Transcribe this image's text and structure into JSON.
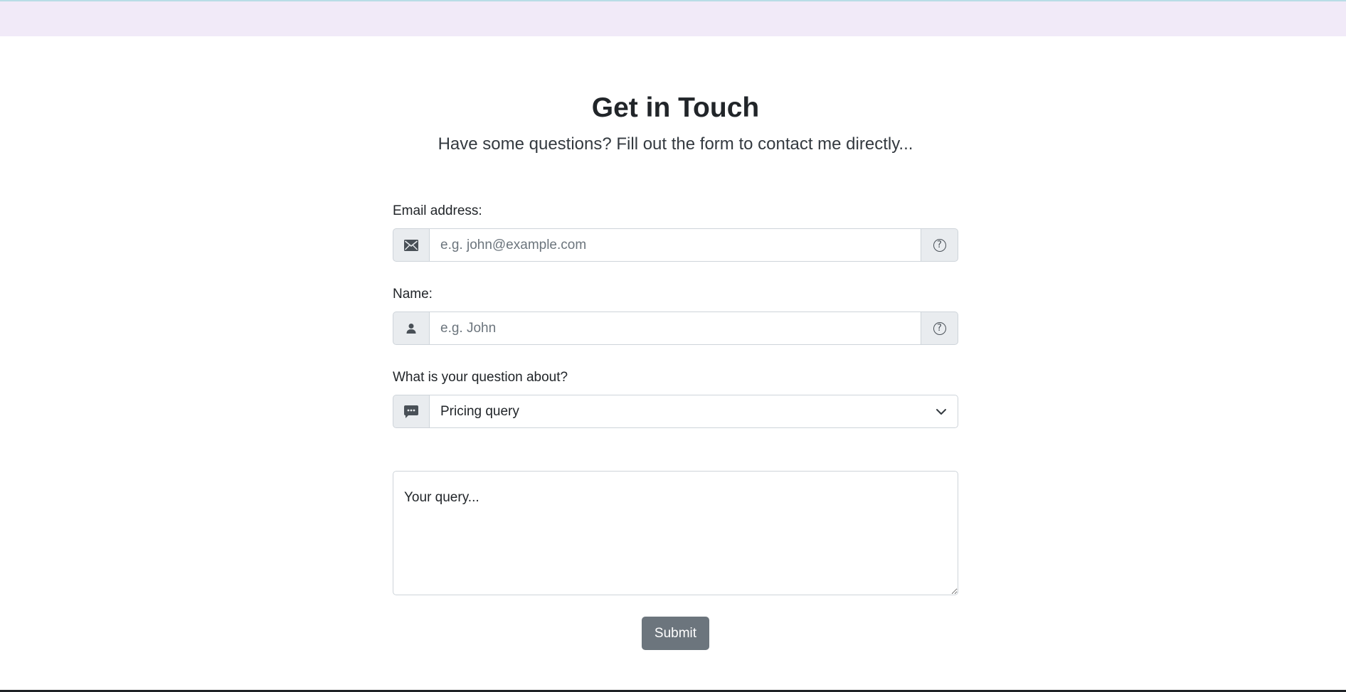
{
  "header": {
    "title": "Get in Touch",
    "subtitle": "Have some questions? Fill out the form to contact me directly..."
  },
  "form": {
    "email": {
      "label": "Email address:",
      "placeholder": "e.g. john@example.com",
      "icon": "envelope-icon",
      "help_icon": "question-circle-icon"
    },
    "name": {
      "label": "Name:",
      "placeholder": "e.g. John",
      "icon": "person-icon",
      "help_icon": "question-circle-icon"
    },
    "topic": {
      "label": "What is your question about?",
      "selected": "Pricing query",
      "icon": "chat-dots-icon"
    },
    "query": {
      "placeholder": "Your query..."
    },
    "submit_label": "Submit"
  },
  "colors": {
    "topbar": "#f1eaf8",
    "submit_bg": "#6c757d",
    "addon_bg": "#e9ecef",
    "border": "#ced4da"
  }
}
